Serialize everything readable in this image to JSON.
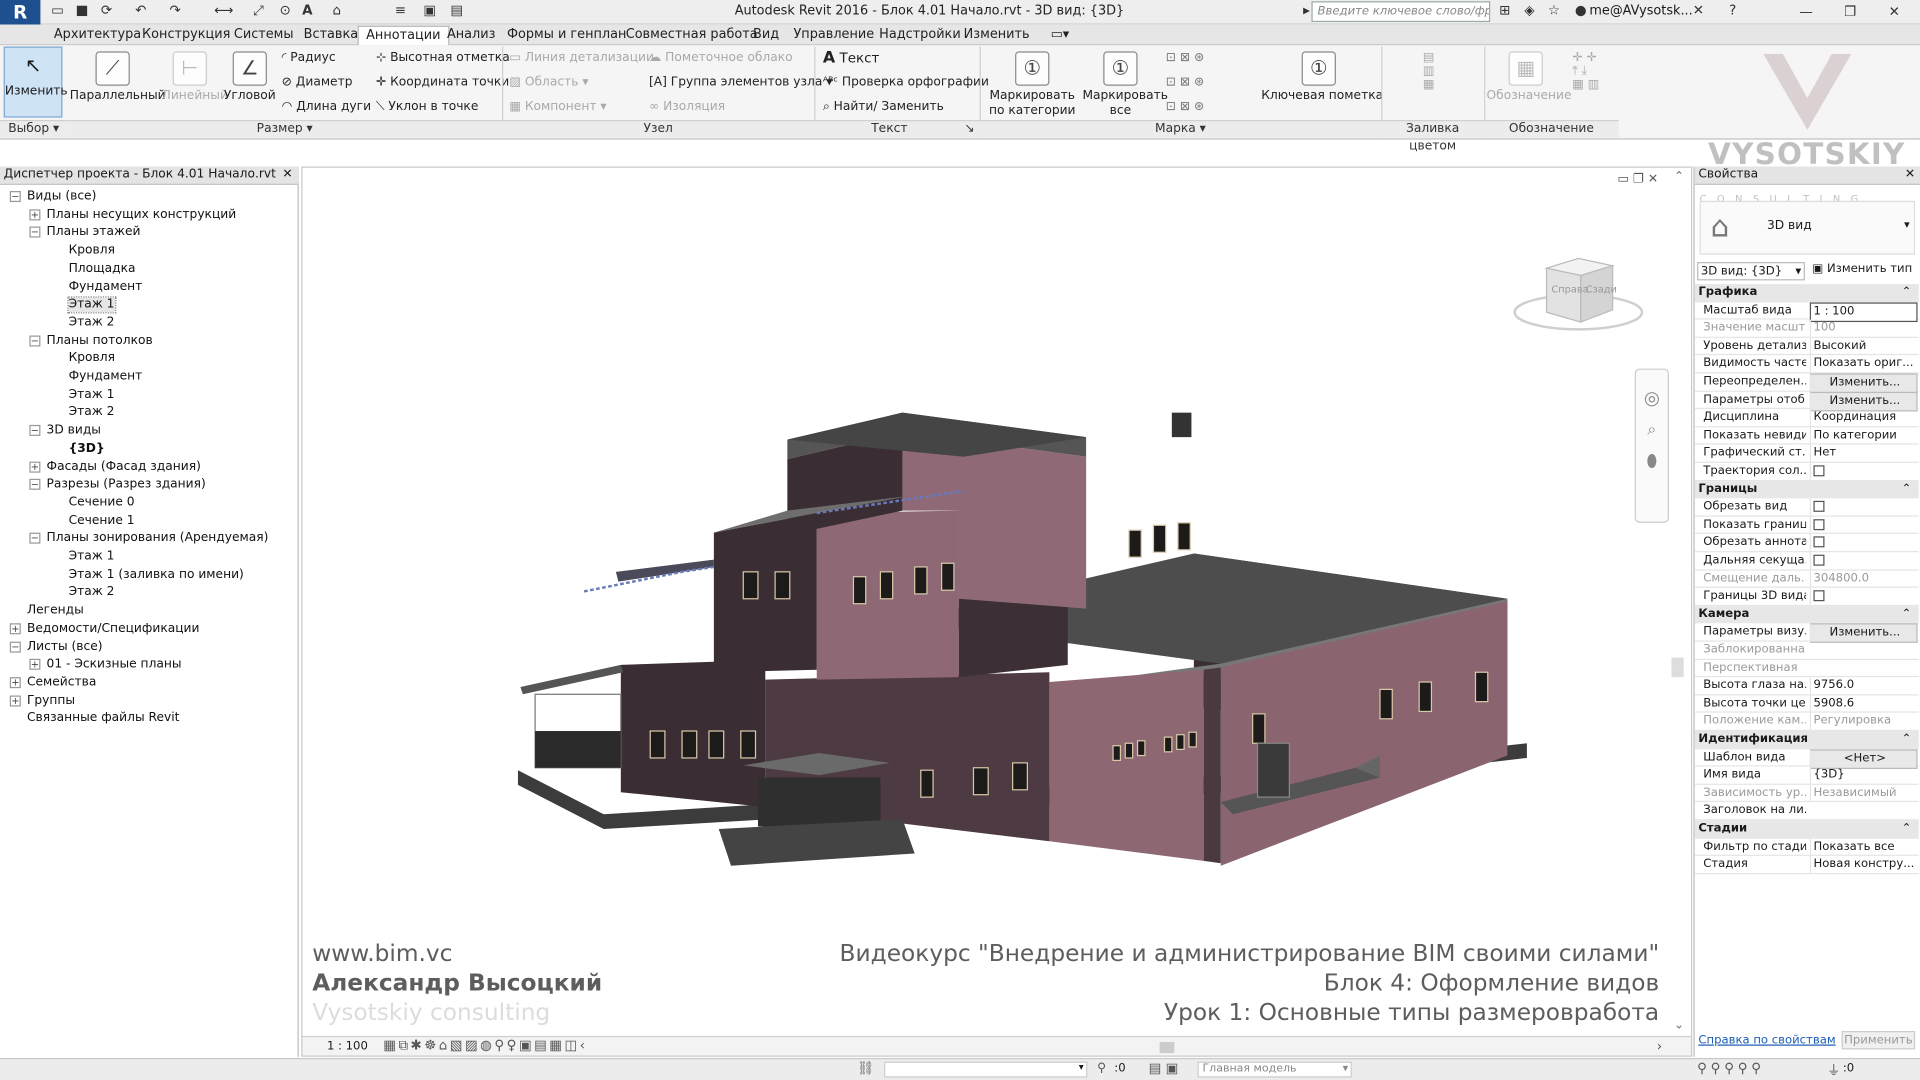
{
  "app": {
    "logo": "R",
    "window_title": "Autodesk Revit 2016 -     Блок 4.01 Начало.rvt - 3D вид: {3D}",
    "search_placeholder": "Введите ключевое слово/фразу",
    "user": "me@AVysotsk..."
  },
  "tabs": [
    "Архитектура",
    "Конструкция",
    "Системы",
    "Вставка",
    "Аннотации",
    "Анализ",
    "Формы и генплан",
    "Совместная работа",
    "Вид",
    "Управление",
    "Надстройки",
    "Изменить"
  ],
  "active_tab": "Аннотации",
  "ribbon": {
    "modify": "Изменить",
    "dims_big": [
      "Параллельный",
      "Линейный",
      "Угловой"
    ],
    "dims_small": [
      "Радиус",
      "Диаметр",
      "Длина дуги",
      "Высотная отметка",
      "Координата точки",
      "Уклон  в точке"
    ],
    "detail": [
      "Линия детализации",
      "Пометочное облако",
      "Область",
      "Группа элементов узла",
      "Компонент",
      "Изоляция"
    ],
    "text": [
      "Текст",
      "Проверка  орфографии",
      "Найти/ Заменить"
    ],
    "tag_big": [
      "Маркировать по категории",
      "Маркировать все",
      "Ключевая пометка",
      "Обозначение"
    ],
    "panels": [
      "Выбор",
      "Размер",
      "Узел",
      "Текст",
      "Марка",
      "Заливка цветом",
      "Обозначение"
    ]
  },
  "browser": {
    "title": "Диспетчер проекта - Блок 4.01 Начало.rvt",
    "items": [
      {
        "t": "Виды (все)",
        "l": 0,
        "g": "−"
      },
      {
        "t": "Планы несущих конструкций",
        "l": 1,
        "g": "+"
      },
      {
        "t": "Планы этажей",
        "l": 1,
        "g": "−"
      },
      {
        "t": "Кровля",
        "l": 2
      },
      {
        "t": "Площадка",
        "l": 2
      },
      {
        "t": "Фундамент",
        "l": 2
      },
      {
        "t": "Этаж 1",
        "l": 2,
        "sel": true
      },
      {
        "t": "Этаж 2",
        "l": 2
      },
      {
        "t": "Планы потолков",
        "l": 1,
        "g": "−"
      },
      {
        "t": "Кровля",
        "l": 2
      },
      {
        "t": "Фундамент",
        "l": 2
      },
      {
        "t": "Этаж 1",
        "l": 2
      },
      {
        "t": "Этаж 2",
        "l": 2
      },
      {
        "t": "3D виды",
        "l": 1,
        "g": "−"
      },
      {
        "t": "{3D}",
        "l": 2,
        "b": true
      },
      {
        "t": "Фасады (Фасад здания)",
        "l": 1,
        "g": "+"
      },
      {
        "t": "Разрезы (Разрез здания)",
        "l": 1,
        "g": "−"
      },
      {
        "t": "Сечение 0",
        "l": 2
      },
      {
        "t": "Сечение 1",
        "l": 2
      },
      {
        "t": "Планы зонирования (Арендуемая)",
        "l": 1,
        "g": "−"
      },
      {
        "t": "Этаж 1",
        "l": 2
      },
      {
        "t": "Этаж 1 (заливка по имени)",
        "l": 2
      },
      {
        "t": "Этаж 2",
        "l": 2
      },
      {
        "t": "Легенды",
        "l": 0,
        "g": ""
      },
      {
        "t": "Ведомости/Спецификации",
        "l": 0,
        "g": "+"
      },
      {
        "t": "Листы (все)",
        "l": 0,
        "g": "−"
      },
      {
        "t": "01 - Эскизные планы",
        "l": 1,
        "g": "+"
      },
      {
        "t": "Семейства",
        "l": 0,
        "g": "+"
      },
      {
        "t": "Группы",
        "l": 0,
        "g": "+"
      },
      {
        "t": "Связанные файлы Revit",
        "l": 0,
        "g": ""
      }
    ]
  },
  "view": {
    "viewcube_left": "Справа",
    "viewcube_right": "Сзади",
    "scale": "1 : 100",
    "watermark_left": [
      "www.bim.vc",
      "Александр Высоцкий",
      "Vysotskiy consulting"
    ],
    "watermark_right": [
      "Видеокурс \"Внедрение и администрирование BIM своими силами\"",
      "Блок 4: Оформление видов",
      "Урок 1: Основные типы размероврабoта"
    ],
    "logo_text": "VYSOTSKIY",
    "logo_sub": "C O N S U L T I N G"
  },
  "props": {
    "title": "Свойства",
    "type": "3D вид",
    "selector": "3D вид: {3D}",
    "edit_type": "Изменить тип",
    "groups": [
      {
        "h": "Графика",
        "rows": [
          [
            "Масштаб вида",
            "1 : 100"
          ],
          [
            "Значение масшт...",
            "100",
            "g"
          ],
          [
            "Уровень детализ...",
            "Высокий"
          ],
          [
            "Видимость частей",
            "Показать ориг..."
          ],
          [
            "Переопределен...",
            "Изменить...",
            "b"
          ],
          [
            "Параметры отоб...",
            "Изменить...",
            "b"
          ],
          [
            "Дисциплина",
            "Координация"
          ],
          [
            "Показать невиди...",
            "По категории"
          ],
          [
            "Графический ст...",
            "Нет"
          ],
          [
            "Траектория сол...",
            "",
            "c"
          ]
        ]
      },
      {
        "h": "Границы",
        "rows": [
          [
            "Обрезать вид",
            "",
            "c"
          ],
          [
            "Показать границ...",
            "",
            "c"
          ],
          [
            "Обрезать аннота...",
            "",
            "c"
          ],
          [
            "Дальняя секуща...",
            "",
            "c"
          ],
          [
            "Смещение даль...",
            "304800.0",
            "g"
          ],
          [
            "Границы 3D вида",
            "",
            "c"
          ]
        ]
      },
      {
        "h": "Камера",
        "rows": [
          [
            "Параметры визу...",
            "Изменить...",
            "b"
          ],
          [
            "Заблокированна...",
            "",
            "g"
          ],
          [
            "Перспективная",
            "",
            "g"
          ],
          [
            "Высота глаза на...",
            "9756.0"
          ],
          [
            "Высота точки це...",
            "5908.6"
          ],
          [
            "Положение кам...",
            "Регулировка",
            "g"
          ]
        ]
      },
      {
        "h": "Идентификация",
        "rows": [
          [
            "Шаблон вида",
            "<Нет>",
            "b"
          ],
          [
            "Имя вида",
            "{3D}"
          ],
          [
            "Зависимость ур...",
            "Независимый",
            "g"
          ],
          [
            "Заголовок на ли...",
            ""
          ]
        ]
      },
      {
        "h": "Стадии",
        "rows": [
          [
            "Фильтр по стади...",
            "Показать все"
          ],
          [
            "Стадия",
            "Новая констру..."
          ]
        ]
      }
    ],
    "help_link": "Справка по свойствам",
    "apply": "Применить"
  },
  "status": {
    "model": "Главная модель",
    "zero": ":0"
  }
}
